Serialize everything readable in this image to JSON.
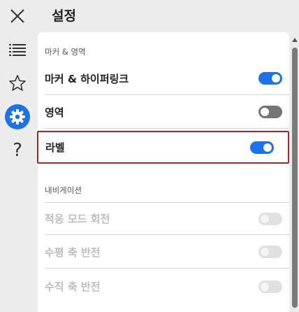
{
  "header": {
    "title": "설정"
  },
  "rail": {
    "items": [
      {
        "icon": "close-icon"
      },
      {
        "icon": "list-icon"
      },
      {
        "icon": "star-icon"
      },
      {
        "icon": "gear-icon",
        "active": true
      },
      {
        "icon": "help-icon",
        "glyph": "?"
      }
    ]
  },
  "sections": [
    {
      "heading": "마커 & 영역",
      "rows": [
        {
          "label": "마커 & 하이퍼링크",
          "state": "on"
        },
        {
          "label": "영역",
          "state": "off"
        },
        {
          "label": "라벨",
          "state": "on",
          "highlighted": true
        }
      ]
    },
    {
      "heading": "내비게이션",
      "rows": [
        {
          "label": "적응 모드 회전",
          "state": "disabled"
        },
        {
          "label": "수평 축 반전",
          "state": "disabled"
        },
        {
          "label": "수직 축 반전",
          "state": "disabled"
        }
      ]
    }
  ],
  "colors": {
    "accent": "#1a73e8",
    "highlight_border": "#a02a2a",
    "toggle_off": "#757575",
    "toggle_disabled": "#e0e0e0"
  }
}
